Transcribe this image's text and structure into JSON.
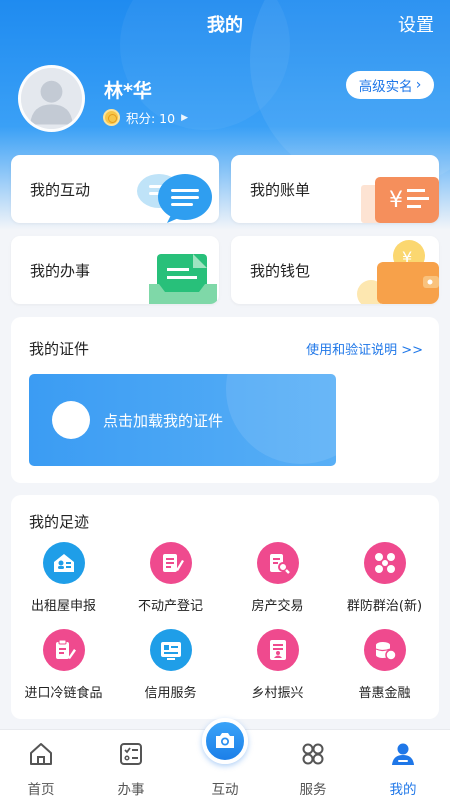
{
  "header": {
    "title": "我的",
    "settings_label": "设置"
  },
  "profile": {
    "name": "林*华",
    "points_label": "积分: 10",
    "verify_label": "高级实名"
  },
  "quick_cards": [
    {
      "label": "我的互动",
      "icon": "chat-bubbles-icon"
    },
    {
      "label": "我的账单",
      "icon": "bill-icon"
    },
    {
      "label": "我的办事",
      "icon": "tray-document-icon"
    },
    {
      "label": "我的钱包",
      "icon": "wallet-icon"
    }
  ],
  "certificates": {
    "title": "我的证件",
    "link": "使用和验证说明 >>",
    "load_label": "点击加载我的证件"
  },
  "footprints": {
    "title": "我的足迹",
    "items": [
      {
        "label": "出租屋申报",
        "icon": "rental-house-icon",
        "color": "#1f9ee8"
      },
      {
        "label": "不动产登记",
        "icon": "register-edit-icon",
        "color": "#ef4a8e"
      },
      {
        "label": "房产交易",
        "icon": "property-search-icon",
        "color": "#ef4a8e"
      },
      {
        "label": "群防群治(新)",
        "icon": "group-defense-icon",
        "color": "#ef4a8e"
      },
      {
        "label": "进口冷链食品",
        "icon": "clipboard-edit-icon",
        "color": "#ef4a8e"
      },
      {
        "label": "信用服务",
        "icon": "credit-card-icon",
        "color": "#1f9ee8"
      },
      {
        "label": "乡村振兴",
        "icon": "document-person-icon",
        "color": "#ef4a8e"
      },
      {
        "label": "普惠金融",
        "icon": "coins-icon",
        "color": "#ef4a8e"
      }
    ]
  },
  "tabbar": {
    "items": [
      {
        "label": "首页",
        "icon": "home-icon"
      },
      {
        "label": "办事",
        "icon": "checklist-icon"
      },
      {
        "label": "互动",
        "icon": "camera-icon"
      },
      {
        "label": "服务",
        "icon": "grid-icon"
      },
      {
        "label": "我的",
        "icon": "person-icon"
      }
    ],
    "active": "我的"
  },
  "colors": {
    "primary": "#1f77e8",
    "header_blue": "#1f8bf0",
    "pink": "#ef4a8e"
  }
}
